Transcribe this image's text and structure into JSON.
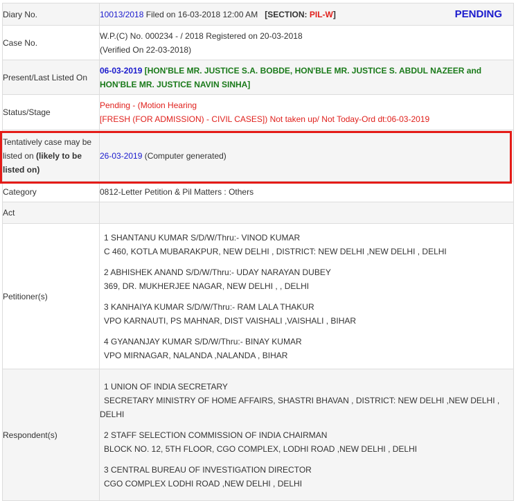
{
  "diary": {
    "label": "Diary No.",
    "number": "10013/2018",
    "filed": " Filed on 16-03-2018 12:00 AM",
    "section_prefix": "[SECTION: ",
    "section": "PIL-W",
    "section_suffix": "]",
    "status": "PENDING"
  },
  "case": {
    "label": "Case No.",
    "line1": "W.P.(C) No. 000234 - / 2018  Registered on 20-03-2018",
    "line2": "(Verified On 22-03-2018)"
  },
  "listed": {
    "label": "Present/Last Listed On",
    "date": "06-03-2019",
    "bench_line1": " [HON'BLE MR. JUSTICE S.A. BOBDE, HON'BLE MR. JUSTICE S. ABDUL NAZEER and",
    "bench_line2": "HON'BLE MR. JUSTICE NAVIN SINHA]"
  },
  "status": {
    "label": "Status/Stage",
    "line1": "Pending - (Motion Hearing",
    "line2": "[FRESH (FOR ADMISSION) - CIVIL CASES]) Not taken up/ Not Today-Ord dt:06-03-2019"
  },
  "tentative": {
    "label_plain": "Tentatively case may be listed on ",
    "label_bold": "(likely to be listed on)",
    "date": "26-03-2019",
    "note": " (Computer generated)"
  },
  "category": {
    "label": "Category",
    "value": "0812-Letter Petition & Pil Matters : Others"
  },
  "act": {
    "label": "Act",
    "value": ""
  },
  "petitioners": {
    "label": "Petitioner(s)",
    "items": [
      {
        "line1": "1 SHANTANU KUMAR S/D/W/Thru:- VINOD KUMAR",
        "line2": "C 460, KOTLA MUBARAKPUR, NEW DELHI , DISTRICT: NEW DELHI ,NEW DELHI , DELHI"
      },
      {
        "line1": "2 ABHISHEK ANAND S/D/W/Thru:- UDAY NARAYAN DUBEY",
        "line2": "369, DR. MUKHERJEE NAGAR, NEW DELHI , , DELHI"
      },
      {
        "line1": "3 KANHAIYA KUMAR S/D/W/Thru:- RAM LALA THAKUR",
        "line2": "VPO KARNAUTI, PS MAHNAR, DIST VAISHALI ,VAISHALI , BIHAR"
      },
      {
        "line1": "4 GYANANJAY KUMAR S/D/W/Thru:- BINAY KUMAR",
        "line2": "VPO MIRNAGAR, NALANDA ,NALANDA , BIHAR"
      }
    ]
  },
  "respondents": {
    "label": "Respondent(s)",
    "items": [
      {
        "line1": "1 UNION OF INDIA SECRETARY",
        "line2": "SECRETARY MINISTRY OF HOME AFFAIRS, SHASTRI BHAVAN , DISTRICT: NEW DELHI ,NEW DELHI ,",
        "line3": "DELHI"
      },
      {
        "line1": "2 STAFF SELECTION COMMISSION OF INDIA CHAIRMAN",
        "line2": "BLOCK NO. 12, 5TH FLOOR, CGO COMPLEX, LODHI ROAD ,NEW DELHI , DELHI"
      },
      {
        "line1": "3 CENTRAL BUREAU OF INVESTIGATION DIRECTOR",
        "line2": "CGO COMPLEX LODHI ROAD ,NEW DELHI , DELHI"
      }
    ]
  },
  "colors": {
    "date_blue": "#1a1acd",
    "bench_green": "#1a7a1a",
    "status_red": "#e0201c",
    "highlight_red": "#e41b17"
  }
}
